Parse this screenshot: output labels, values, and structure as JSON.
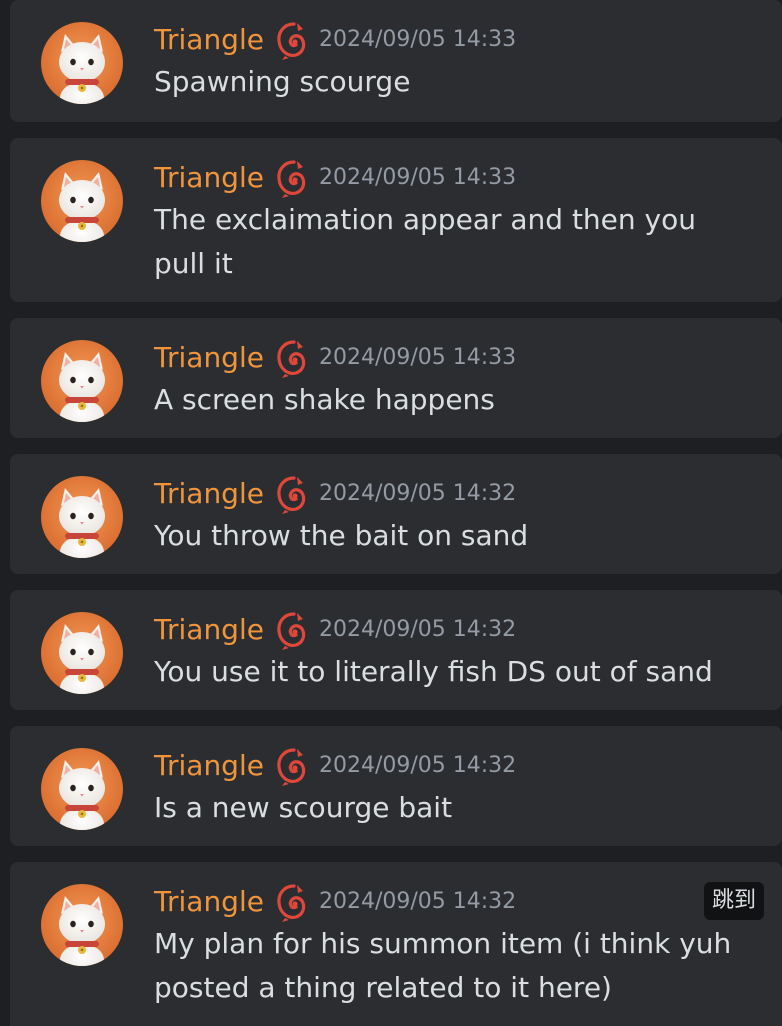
{
  "messages": [
    {
      "author": "Triangle",
      "timestamp": "2024/09/05 14:33",
      "content": "Spawning scourge"
    },
    {
      "author": "Triangle",
      "timestamp": "2024/09/05 14:33",
      "content": "The exclaimation appear and then you pull it"
    },
    {
      "author": "Triangle",
      "timestamp": "2024/09/05 14:33",
      "content": "A screen shake happens"
    },
    {
      "author": "Triangle",
      "timestamp": "2024/09/05 14:32",
      "content": "You throw the bait on sand"
    },
    {
      "author": "Triangle",
      "timestamp": "2024/09/05 14:32",
      "content": "You use it to literally fish DS out of sand"
    },
    {
      "author": "Triangle",
      "timestamp": "2024/09/05 14:32",
      "content": "Is a new scourge bait"
    },
    {
      "author": "Triangle",
      "timestamp": "2024/09/05 14:32",
      "content": "My plan for his summon item (i think yuh posted a thing related to it here)",
      "jump_label": "跳到"
    }
  ],
  "colors": {
    "author": "#f0953c",
    "timestamp": "#949ba4",
    "content": "#dbdee1",
    "card_bg": "#2b2d31",
    "page_bg": "#1e1f22",
    "avatar_bg": "#e07a3c"
  },
  "icons": {
    "avatar": "white-cat-avatar",
    "role": "red-swirl-role-icon"
  }
}
